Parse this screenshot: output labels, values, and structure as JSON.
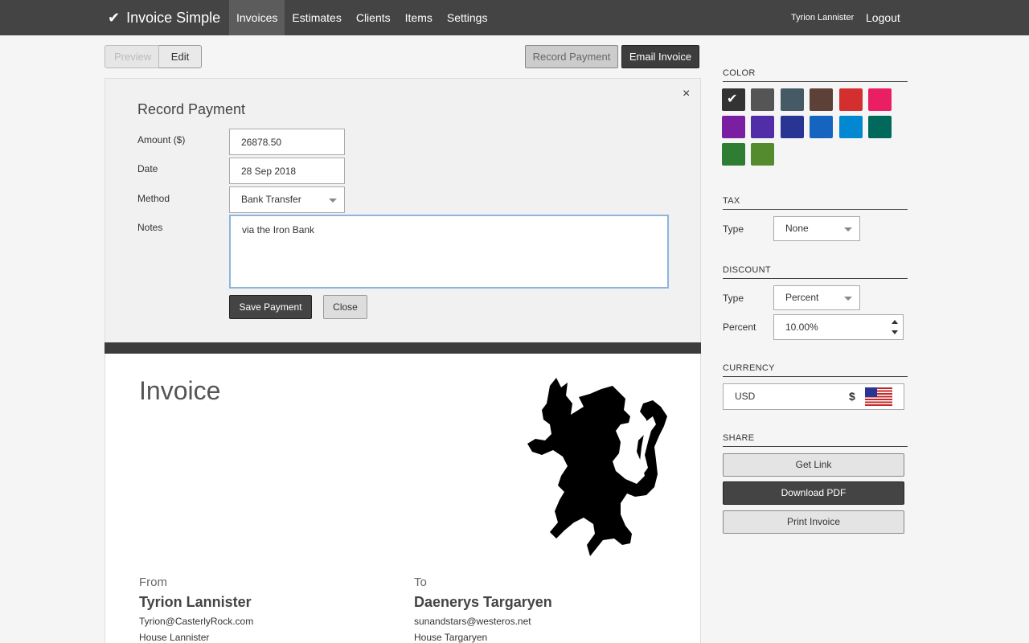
{
  "topbar": {
    "brand": "Invoice Simple",
    "nav": [
      "Invoices",
      "Estimates",
      "Clients",
      "Items",
      "Settings"
    ],
    "active_nav": "Invoices",
    "user": "Tyrion Lannister",
    "logout": "Logout"
  },
  "toolbar": {
    "preview": "Preview",
    "edit": "Edit",
    "record_payment": "Record Payment",
    "email_invoice": "Email Invoice"
  },
  "payment_form": {
    "title": "Record Payment",
    "close_symbol": "×",
    "amount_label": "Amount ($)",
    "amount_value": "26878.50",
    "date_label": "Date",
    "date_value": "28 Sep 2018",
    "method_label": "Method",
    "method_value": "Bank Transfer",
    "notes_label": "Notes",
    "notes_value": "via the Iron Bank",
    "save_button": "Save Payment",
    "close_button": "Close"
  },
  "invoice": {
    "title": "Invoice",
    "from_label": "From",
    "from_name": "Tyrion Lannister",
    "from_email": "Tyrion@CasterlyRock.com",
    "from_company": "House Lannister",
    "to_label": "To",
    "to_name": "Daenerys Targaryen",
    "to_email": "sunandstars@westeros.net",
    "to_company": "House Targaryen"
  },
  "sidebar": {
    "color_title": "COLOR",
    "colors": [
      "#333333",
      "#555555",
      "#455a64",
      "#5d4037",
      "#d32f2f",
      "#e91e63",
      "#7b1fa2",
      "#512da8",
      "#283593",
      "#1565c0",
      "#0288d1",
      "#00695c",
      "#2e7d32",
      "#558b2f"
    ],
    "selected_color": "#333333",
    "tax_title": "TAX",
    "tax_type_label": "Type",
    "tax_type_value": "None",
    "discount_title": "DISCOUNT",
    "discount_type_label": "Type",
    "discount_type_value": "Percent",
    "discount_percent_label": "Percent",
    "discount_percent_value": "10.00%",
    "currency_title": "CURRENCY",
    "currency_code": "USD",
    "currency_symbol": "$",
    "currency_flag_icon": "us-flag-icon",
    "share_title": "SHARE",
    "get_link": "Get Link",
    "download_pdf": "Download PDF",
    "print_invoice": "Print Invoice"
  }
}
